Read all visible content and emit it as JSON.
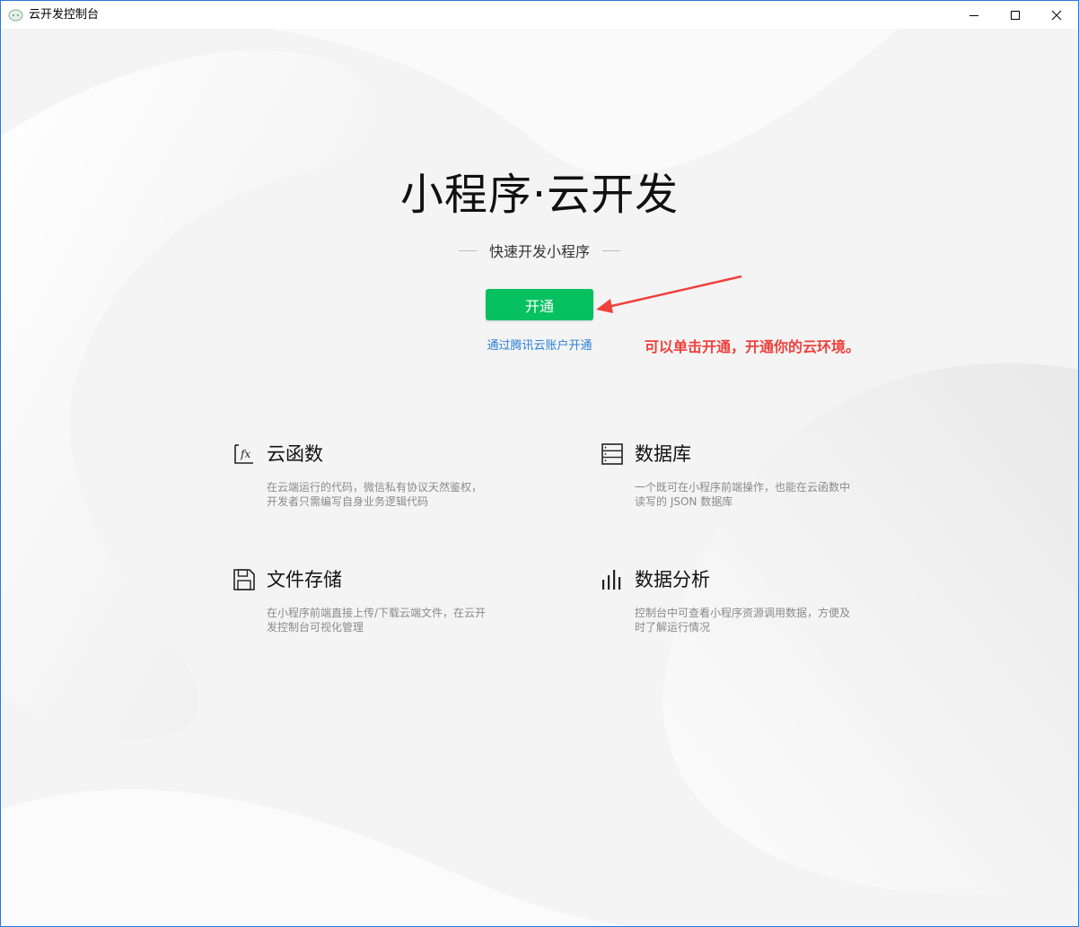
{
  "window": {
    "title": "云开发控制台",
    "controls": {
      "minimize": "minimize-icon",
      "maximize": "maximize-icon",
      "close": "close-icon"
    }
  },
  "hero": {
    "title": "小程序·云开发",
    "subtitle": "快速开发小程序",
    "open_button": "开通",
    "tencent_link": "通过腾讯云账户开通"
  },
  "annotation": {
    "text": "可以单击开通，开通你的云环境。",
    "color": "#f0403c"
  },
  "features": [
    {
      "icon": "function-fx-icon",
      "title": "云函数",
      "desc_line1": "在云端运行的代码，微信私有协议天然鉴权，",
      "desc_line2": "开发者只需编写自身业务逻辑代码"
    },
    {
      "icon": "database-icon",
      "title": "数据库",
      "desc_line1": "一个既可在小程序前端操作，也能在云函数中",
      "desc_line2": "读写的 JSON 数据库"
    },
    {
      "icon": "storage-disk-icon",
      "title": "文件存储",
      "desc_line1": "在小程序前端直接上传/下载云端文件，在云开",
      "desc_line2": "发控制台可视化管理"
    },
    {
      "icon": "bar-chart-icon",
      "title": "数据分析",
      "desc_line1": "控制台中可查看小程序资源调用数据，方便及",
      "desc_line2": "时了解运行情况"
    }
  ],
  "colors": {
    "accent_green": "#07c160",
    "link_blue": "#2e7fd6",
    "annotation_red": "#f0403c",
    "window_border": "#2b78d6"
  }
}
